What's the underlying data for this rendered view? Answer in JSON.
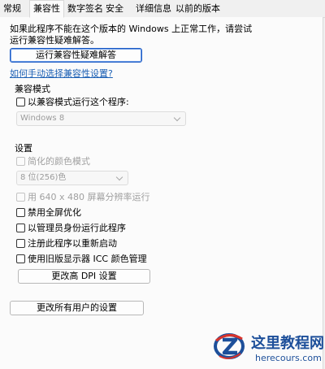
{
  "tabs": [
    {
      "label": "常规"
    },
    {
      "label": "兼容性"
    },
    {
      "label": "数字签名"
    },
    {
      "label": "安全"
    },
    {
      "label": "详细信息"
    },
    {
      "label": "以前的版本"
    }
  ],
  "intro_text": "如果此程序不能在这个版本的 Windows 上正常工作，请尝试运行兼容性疑难解答。",
  "troubleshoot_button": "运行兼容性疑难解答",
  "manual_link": "如何手动选择兼容性设置?",
  "compat_mode": {
    "label": "兼容模式",
    "checkbox": "以兼容模式运行这个程序:",
    "selected_os": "Windows 8"
  },
  "settings": {
    "label": "设置",
    "reduced_color": "简化的颜色模式",
    "color_value": "8 位(256)色",
    "run_640": "用 640 x 480 屏幕分辨率运行",
    "disable_fullscreen": "禁用全屏优化",
    "run_as_admin": "以管理员身份运行此程序",
    "register_restart": "注册此程序以重新启动",
    "legacy_icc": "使用旧版显示器 ICC 颜色管理",
    "dpi_button": "更改高 DPI 设置"
  },
  "all_users_button": "更改所有用户的设置",
  "watermark": {
    "title": "这里教程网",
    "url": "herecours.com",
    "primary_color": "#1d4f9a",
    "accent_color": "#d8332b"
  }
}
